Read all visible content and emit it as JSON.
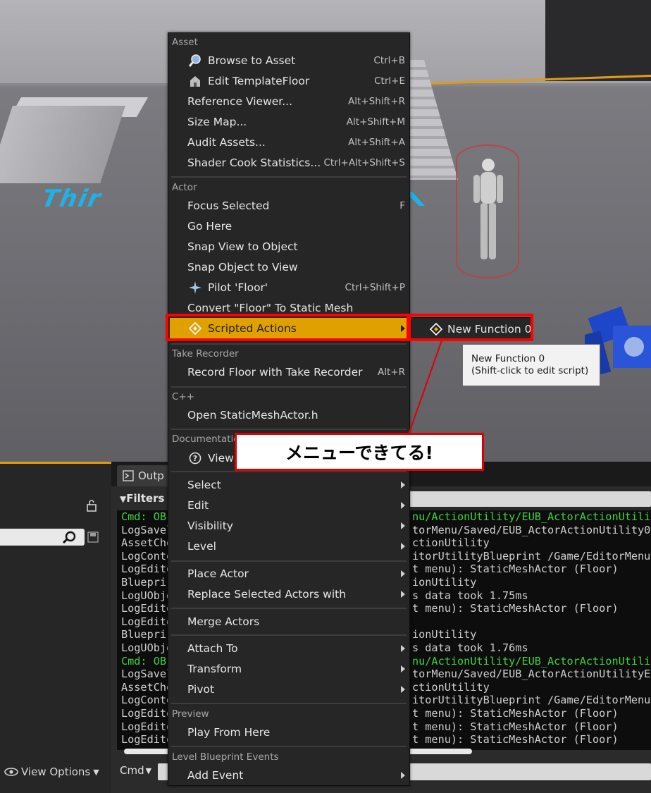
{
  "menu": {
    "sections": [
      {
        "header": "Asset",
        "items": [
          {
            "label": "Browse to Asset",
            "shortcut": "Ctrl+B",
            "icon": "magnifier-icon"
          },
          {
            "label": "Edit TemplateFloor",
            "shortcut": "Ctrl+E",
            "icon": "asset-editor-icon"
          },
          {
            "label": "Reference Viewer...",
            "shortcut": "Alt+Shift+R"
          },
          {
            "label": "Size Map...",
            "shortcut": "Alt+Shift+M"
          },
          {
            "label": "Audit Assets...",
            "shortcut": "Alt+Shift+A"
          },
          {
            "label": "Shader Cook Statistics...",
            "shortcut": "Ctrl+Alt+Shift+S"
          }
        ]
      },
      {
        "header": "Actor",
        "items": [
          {
            "label": "Focus Selected",
            "shortcut": "F"
          },
          {
            "label": "Go Here"
          },
          {
            "label": "Snap View to Object"
          },
          {
            "label": "Snap Object to View"
          },
          {
            "label": "Pilot 'Floor'",
            "shortcut": "Ctrl+Shift+P",
            "icon": "airplane-icon"
          },
          {
            "label": "Convert \"Floor\" To Static Mesh"
          },
          {
            "label": "Scripted Actions",
            "icon": "scripted-action-icon",
            "submenu": true,
            "highlighted": true
          }
        ]
      },
      {
        "header": "Take Recorder",
        "items": [
          {
            "label": "Record Floor with Take Recorder",
            "shortcut": "Alt+R"
          }
        ]
      },
      {
        "header": "C++",
        "items": [
          {
            "label": "Open StaticMeshActor.h"
          }
        ]
      },
      {
        "header": "Documentation",
        "items": [
          {
            "label": "View",
            "icon": "help-icon"
          }
        ]
      },
      {
        "header": "",
        "items": [
          {
            "label": "Select",
            "submenu": true
          },
          {
            "label": "Edit",
            "submenu": true
          },
          {
            "label": "Visibility",
            "submenu": true
          },
          {
            "label": "Level",
            "submenu": true
          }
        ]
      },
      {
        "header": "",
        "items": [
          {
            "label": "Place Actor",
            "submenu": true
          },
          {
            "label": "Replace Selected Actors with",
            "submenu": true
          }
        ]
      },
      {
        "header": "",
        "items": [
          {
            "label": "Merge Actors"
          }
        ]
      },
      {
        "header": "",
        "items": [
          {
            "label": "Attach To",
            "submenu": true
          },
          {
            "label": "Transform",
            "submenu": true
          },
          {
            "label": "Pivot",
            "submenu": true
          }
        ]
      },
      {
        "header": "Preview",
        "items": [
          {
            "label": "Play From Here"
          }
        ]
      },
      {
        "header": "Level Blueprint Events",
        "items": [
          {
            "label": "Add Event",
            "submenu": true
          }
        ]
      }
    ]
  },
  "submenu": {
    "label": "New Function 0",
    "icon": "scripted-action-icon"
  },
  "tooltip": {
    "line1": "New Function 0",
    "line2": "(Shift-click to edit script)"
  },
  "annotation": {
    "callout": "メニューできてる!",
    "color": "#ff0000"
  },
  "viewport": {
    "overlay_text": "Thir"
  },
  "output": {
    "tab_label": "Outp",
    "filters_label": "Filters",
    "cmd_label": "Cmd",
    "log_rows": [
      {
        "left": "Cmd: OB.",
        "right": "nu/ActionUtility/EUB_ActorActionUtili",
        "green": true
      },
      {
        "left": "LogSavel",
        "right": "torMenu/Saved/EUB_ActorActionUtility0"
      },
      {
        "left": "AssetChe",
        "right": "ctionUtility"
      },
      {
        "left": "LogConte",
        "right": "itorUtilityBlueprint /Game/EditorMenu"
      },
      {
        "left": "LogEdito",
        "right": "t menu): StaticMeshActor (Floor)"
      },
      {
        "left": "Bluepri",
        "right": "ionUtility"
      },
      {
        "left": "LogUObje",
        "right": "s data took   1.75ms"
      },
      {
        "left": "LogEdito",
        "right": "t menu): StaticMeshActor (Floor)"
      },
      {
        "left": "LogEdito",
        "right": ""
      },
      {
        "left": "Bluepri",
        "right": "ionUtility"
      },
      {
        "left": "LogUObje",
        "right": "s data took   1.76ms"
      },
      {
        "left": "Cmd: OB.",
        "right": "nu/ActionUtility/EUB_ActorActionUtili",
        "green": true
      },
      {
        "left": "LogSavel",
        "right": "torMenu/Saved/EUB_ActorActionUtilityE"
      },
      {
        "left": "AssetChe",
        "right": "ctionUtility"
      },
      {
        "left": "LogConte",
        "right": "itorUtilityBlueprint /Game/EditorMenu"
      },
      {
        "left": "LogEdito",
        "right": "t menu): StaticMeshActor (Floor)"
      },
      {
        "left": "LogEdito",
        "right": "t menu): StaticMeshActor (Floor)"
      },
      {
        "left": "LogEdito",
        "right": "t menu): StaticMeshActor (Floor)"
      }
    ]
  },
  "left_panel": {
    "view_options_label": "View Options"
  },
  "colors": {
    "accent": "#e0a000",
    "annotation_red": "#ff0000",
    "log_green": "#3fd13f"
  }
}
